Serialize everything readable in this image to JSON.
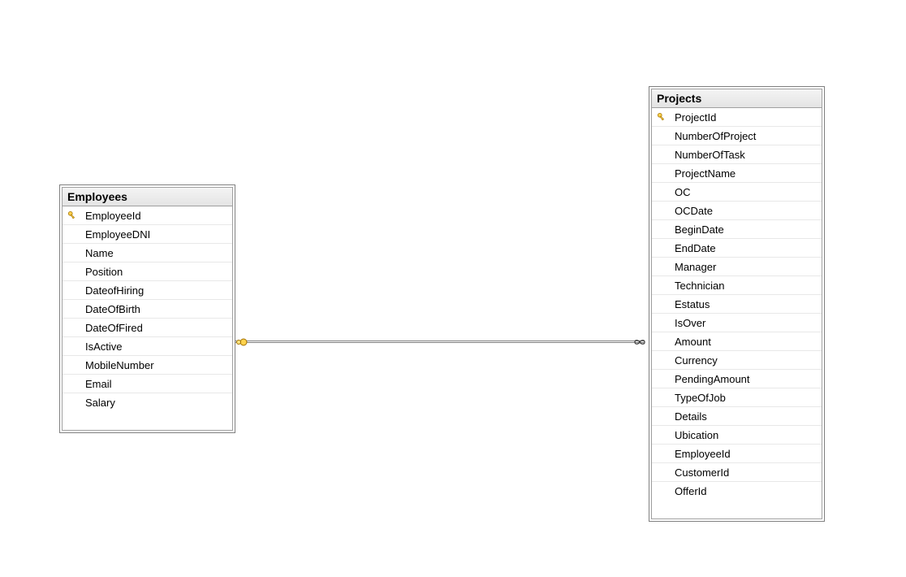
{
  "tables": {
    "employees": {
      "title": "Employees",
      "columns": [
        {
          "name": "EmployeeId",
          "pk": true
        },
        {
          "name": "EmployeeDNI",
          "pk": false
        },
        {
          "name": "Name",
          "pk": false
        },
        {
          "name": "Position",
          "pk": false
        },
        {
          "name": "DateofHiring",
          "pk": false
        },
        {
          "name": "DateOfBirth",
          "pk": false
        },
        {
          "name": "DateOfFired",
          "pk": false
        },
        {
          "name": "IsActive",
          "pk": false
        },
        {
          "name": "MobileNumber",
          "pk": false
        },
        {
          "name": "Email",
          "pk": false
        },
        {
          "name": "Salary",
          "pk": false
        }
      ]
    },
    "projects": {
      "title": "Projects",
      "columns": [
        {
          "name": "ProjectId",
          "pk": true
        },
        {
          "name": "NumberOfProject",
          "pk": false
        },
        {
          "name": "NumberOfTask",
          "pk": false
        },
        {
          "name": "ProjectName",
          "pk": false
        },
        {
          "name": "OC",
          "pk": false
        },
        {
          "name": "OCDate",
          "pk": false
        },
        {
          "name": "BeginDate",
          "pk": false
        },
        {
          "name": "EndDate",
          "pk": false
        },
        {
          "name": "Manager",
          "pk": false
        },
        {
          "name": "Technician",
          "pk": false
        },
        {
          "name": "Estatus",
          "pk": false
        },
        {
          "name": "IsOver",
          "pk": false
        },
        {
          "name": "Amount",
          "pk": false
        },
        {
          "name": "Currency",
          "pk": false
        },
        {
          "name": "PendingAmount",
          "pk": false
        },
        {
          "name": "TypeOfJob",
          "pk": false
        },
        {
          "name": "Details",
          "pk": false
        },
        {
          "name": "Ubication",
          "pk": false
        },
        {
          "name": "EmployeeId",
          "pk": false
        },
        {
          "name": "CustomerId",
          "pk": false
        },
        {
          "name": "OfferId",
          "pk": false
        }
      ]
    }
  },
  "relationship": {
    "from": "Employees",
    "to": "Projects",
    "type": "one-to-many"
  }
}
